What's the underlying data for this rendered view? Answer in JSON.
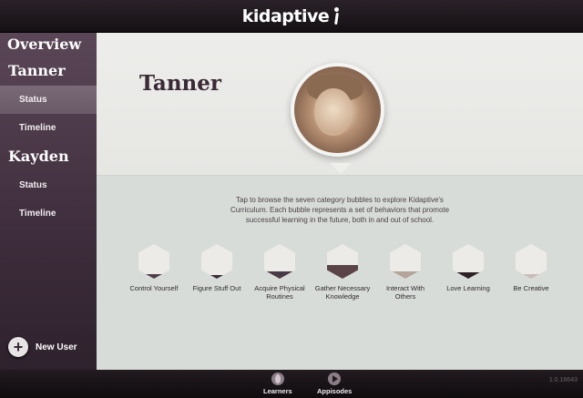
{
  "app": {
    "logo_text": "kidaptive"
  },
  "sidebar": {
    "overview_label": "Overview",
    "learners": [
      {
        "name": "Tanner",
        "items": [
          {
            "label": "Status",
            "active": true
          },
          {
            "label": "Timeline",
            "active": false
          }
        ]
      },
      {
        "name": "Kayden",
        "items": [
          {
            "label": "Status",
            "active": false
          },
          {
            "label": "Timeline",
            "active": false
          }
        ]
      }
    ],
    "new_user_label": "New User",
    "new_user_symbol": "+"
  },
  "main": {
    "learner_name": "Tanner",
    "avatar": "child-photo",
    "intro_text": "Tap to browse the seven category bubbles to explore Kidaptive's Curriculum. Each bubble represents a set of behaviors that promote successful learning in the future, both in and out of school.",
    "categories": [
      {
        "label": "Control Yourself",
        "level": 0.14,
        "color": "#4e3e4c"
      },
      {
        "label": "Figure Stuff Out",
        "level": 0.1,
        "color": "#3a2c38"
      },
      {
        "label": "Acquire Physical Routines",
        "level": 0.22,
        "color": "#4a3a46"
      },
      {
        "label": "Gather Necessary Knowledge",
        "level": 0.4,
        "color": "#5a4448"
      },
      {
        "label": "Interact With Others",
        "level": 0.22,
        "color": "#b4a49c"
      },
      {
        "label": "Love Learning",
        "level": 0.18,
        "color": "#2c2228"
      },
      {
        "label": "Be Creative",
        "level": 0.14,
        "color": "#c8bcb6"
      }
    ]
  },
  "bottom_nav": {
    "tabs": [
      {
        "label": "Learners",
        "icon": "leaf-icon"
      },
      {
        "label": "Appisodes",
        "icon": "play-icon"
      }
    ],
    "version": "1.0.16643"
  }
}
